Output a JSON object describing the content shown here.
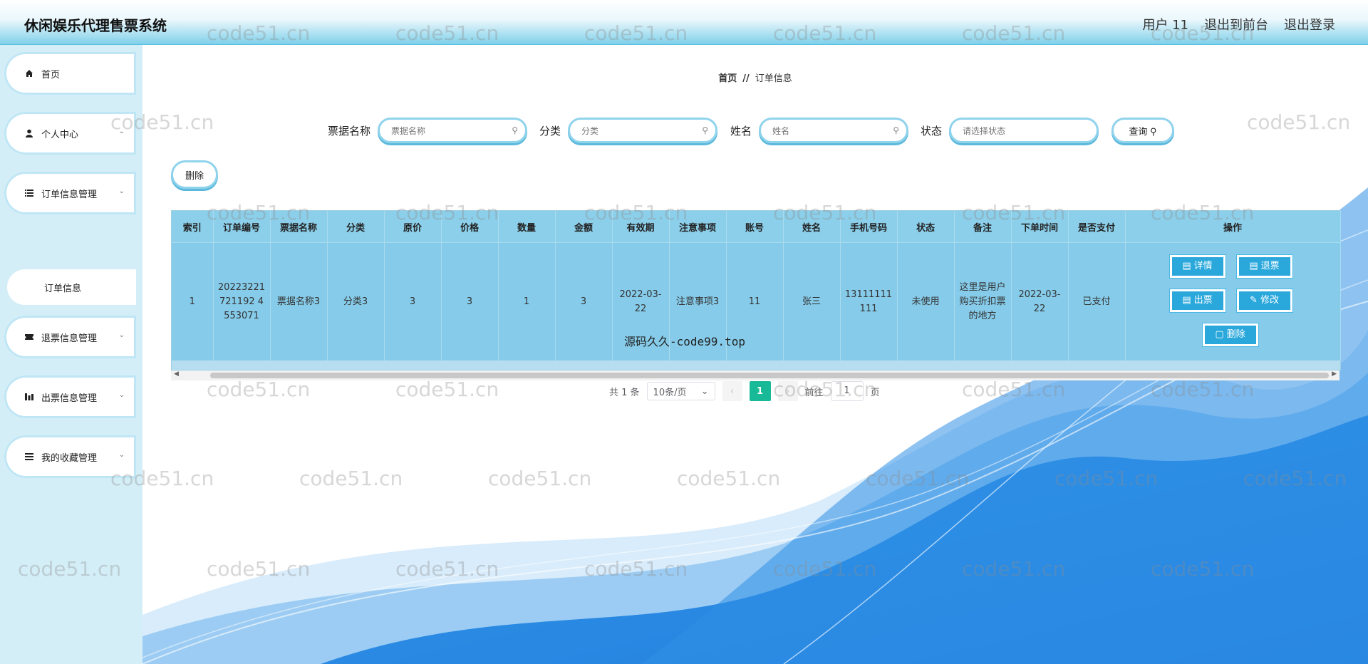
{
  "header": {
    "title": "休闲娱乐代理售票系统",
    "user": "用户 11",
    "to_front": "退出到前台",
    "logout": "退出登录"
  },
  "sidebar": {
    "items": [
      {
        "label": "首页",
        "icon": "home-icon"
      },
      {
        "label": "个人中心",
        "icon": "user-icon"
      },
      {
        "label": "订单信息管理",
        "icon": "list-icon"
      },
      {
        "label": "退票信息管理",
        "icon": "ticket-icon"
      },
      {
        "label": "出票信息管理",
        "icon": "chart-icon"
      },
      {
        "label": "我的收藏管理",
        "icon": "list-icon"
      }
    ],
    "sub_item": "订单信息"
  },
  "breadcrumb": {
    "home": "首页",
    "sep": "//",
    "current": "订单信息"
  },
  "search": {
    "fields": [
      {
        "label": "票据名称",
        "placeholder": "票据名称"
      },
      {
        "label": "分类",
        "placeholder": "分类"
      },
      {
        "label": "姓名",
        "placeholder": "姓名"
      },
      {
        "label": "状态",
        "placeholder": "请选择状态"
      }
    ],
    "button": "查询"
  },
  "toolbar": {
    "delete_label": "删除"
  },
  "table": {
    "headers": [
      "索引",
      "订单编号",
      "票据名称",
      "分类",
      "原价",
      "价格",
      "数量",
      "金额",
      "有效期",
      "注意事项",
      "账号",
      "姓名",
      "手机号码",
      "状态",
      "备注",
      "下单时间",
      "是否支付",
      "操作"
    ],
    "rows": [
      {
        "cells": [
          "1",
          "20223221721192 4553071",
          "票据名称3",
          "分类3",
          "3",
          "3",
          "1",
          "3",
          "2022-03-22",
          "注意事项3",
          "11",
          "张三",
          "13111111111",
          "未使用",
          "这里是用户购买折扣票的地方",
          "2022-03-22",
          "已支付"
        ],
        "actions": [
          "详情",
          "退票",
          "出票",
          "修改",
          "删除"
        ]
      }
    ]
  },
  "overlay_text": "源码久久-code99.top",
  "pagination": {
    "total": "共 1 条",
    "page_size": "10条/页",
    "current_page": "1",
    "goto_label": "前往",
    "goto_value": "1",
    "page_suffix": "页"
  },
  "watermark": "code51.cn",
  "colors": {
    "accent": "#2aa8dc",
    "table_bg": "#86ccea",
    "pager_active": "#18b996"
  }
}
